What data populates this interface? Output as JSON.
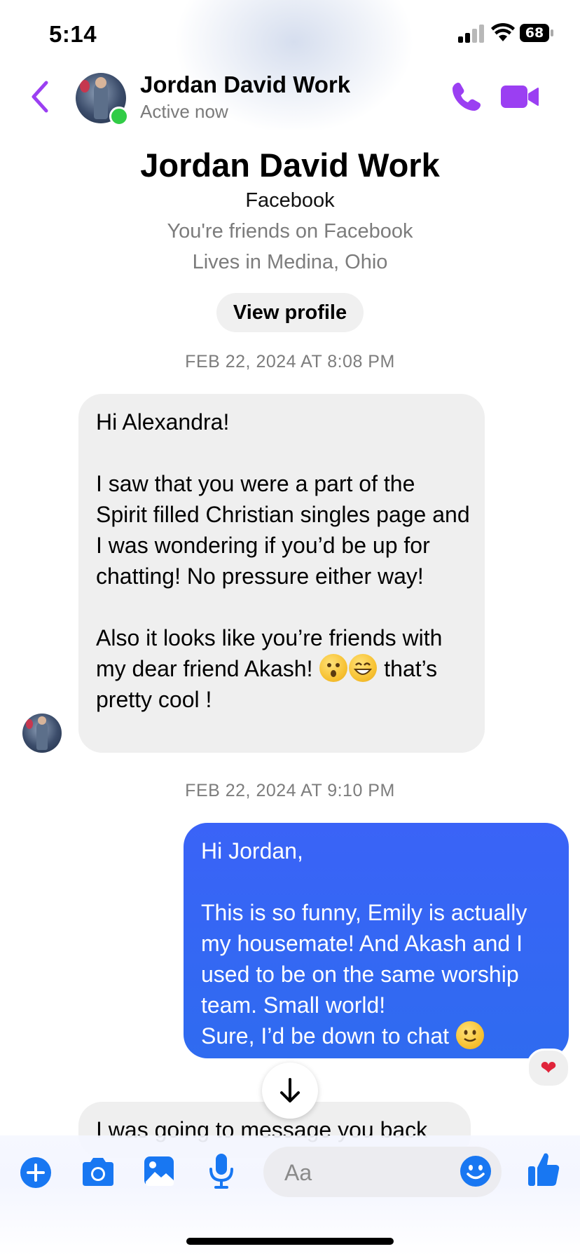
{
  "status_bar": {
    "time": "5:14",
    "battery": "68"
  },
  "header": {
    "contact_name": "Jordan David Work",
    "status": "Active now"
  },
  "profile": {
    "name": "Jordan David Work",
    "platform": "Facebook",
    "line1": "You're friends on Facebook",
    "line2": "Lives in Medina, Ohio",
    "view_profile_label": "View profile"
  },
  "timestamps": [
    "FEB 22, 2024 AT 8:08 PM",
    "FEB 22, 2024 AT 9:10 PM"
  ],
  "messages": [
    {
      "direction": "inbound",
      "text_a": "Hi Alexandra!\n\nI saw that you were a part of the Spirit filled Christian singles page and I was wondering if you’d be up for chatting! No pressure either way!\n\nAlso it looks like you’re friends with my dear friend Akash! ",
      "text_b": " that’s pretty cool !"
    },
    {
      "direction": "outbound",
      "text": "Hi Jordan,\n\nThis is so funny, Emily is actually my housemate! And Akash and I used to be on the same worship team. Small world!\nSure, I’d be down to chat ",
      "reaction": "❤"
    },
    {
      "direction": "inbound",
      "text": "I was going to message you back"
    }
  ],
  "composer": {
    "placeholder": "Aa"
  },
  "colors": {
    "accent_purple": "#9b3ff2",
    "outbound_blue": "#3466f5",
    "online_green": "#31cc46",
    "icon_blue": "#1877f2"
  }
}
